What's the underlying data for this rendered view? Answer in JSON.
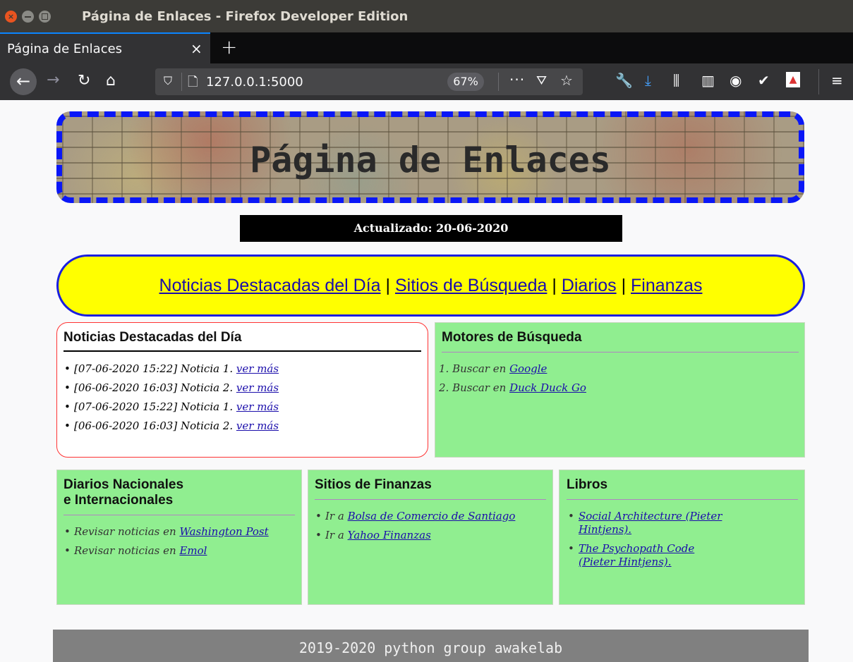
{
  "window": {
    "title": "Página de Enlaces - Firefox Developer Edition"
  },
  "tabs": [
    {
      "label": "Página de Enlaces",
      "close": "×"
    }
  ],
  "newtab_glyph": "+",
  "navbar": {
    "url": "127.0.0.1:5000",
    "zoom": "67%",
    "more": "···"
  },
  "page": {
    "banner_title": "Página de Enlaces",
    "updated": "Actualizado: 20-06-2020",
    "nav_links": [
      "Noticias Destacadas del Día",
      "Sitios de Búsqueda",
      "Diarios",
      "Finanzas"
    ],
    "nav_separator": "|",
    "news": {
      "title": "Noticias Destacadas del Día",
      "items": [
        {
          "text": "[07-06-2020 15:22] Noticia 1. ",
          "link": "ver más"
        },
        {
          "text": "[06-06-2020 16:03] Noticia 2. ",
          "link": "ver más"
        },
        {
          "text": "[07-06-2020 15:22] Noticia 1. ",
          "link": "ver más"
        },
        {
          "text": "[06-06-2020 16:03] Noticia 2. ",
          "link": "ver más"
        }
      ]
    },
    "search": {
      "title": "Motores de Búsqueda",
      "items": [
        {
          "text": "1. Buscar en ",
          "link": "Google"
        },
        {
          "text": "2. Buscar en ",
          "link": "Duck Duck Go"
        }
      ]
    },
    "diarios": {
      "title_line1": "Diarios Nacionales",
      "title_line2": "e Internacionales",
      "items": [
        {
          "text": "Revisar noticias en ",
          "link": "Washington Post"
        },
        {
          "text": "Revisar noticias en ",
          "link": "Emol"
        }
      ]
    },
    "finanzas": {
      "title": "Sitios de Finanzas",
      "items": [
        {
          "text": "Ir a ",
          "link": "Bolsa de Comercio de Santiago"
        },
        {
          "text": "Ir a ",
          "link": "Yahoo Finanzas"
        }
      ]
    },
    "libros": {
      "title": "Libros",
      "items": [
        {
          "link": "Social Architecture (Pieter Hintjens)."
        },
        {
          "link": "The Psychopath Code (Pieter Hintjens)."
        }
      ]
    },
    "footer": "2019-2020 python group awakelab"
  },
  "colors": {
    "banner_border": "#0a17f7",
    "nav_pill_bg": "#ffff00",
    "nav_pill_border": "#1a1ee0",
    "panel_green": "#90ee90",
    "news_border": "#ff3333",
    "footer_bg": "#808080"
  },
  "icons": {
    "toolbar": [
      "wrench-icon",
      "download-icon",
      "library-icon",
      "sidebar-icon",
      "account-icon",
      "extension-check-icon",
      "extension-flag-icon",
      "menu-icon"
    ]
  }
}
